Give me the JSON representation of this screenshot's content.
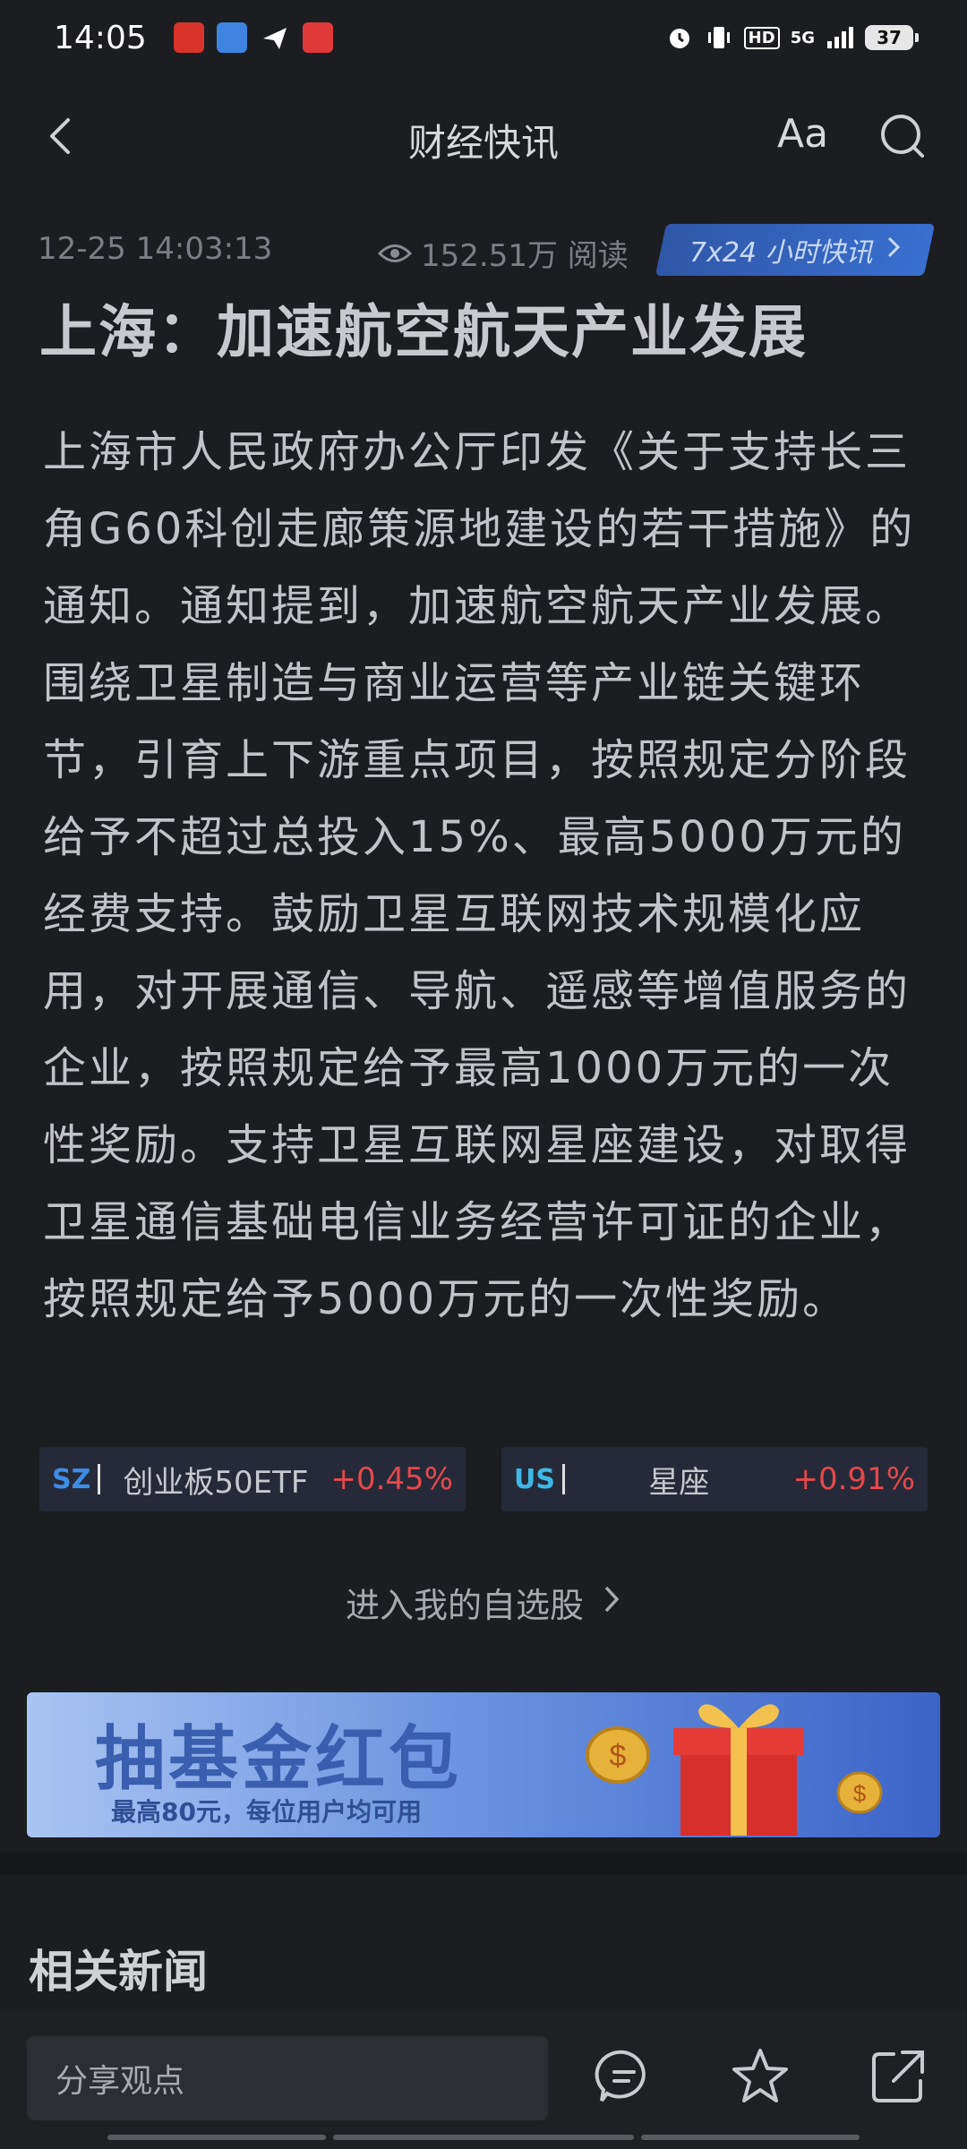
{
  "status_bar": {
    "time": "14:05",
    "battery": "37",
    "network": "5G",
    "hd": "HD"
  },
  "nav": {
    "title": "财经快讯",
    "font_button": "Aa"
  },
  "article": {
    "timestamp": "12-25 14:03:13",
    "views": "152.51万 阅读",
    "badge": "7x24 小时快讯",
    "headline": "上海：加速航空航天产业发展",
    "body": "上海市人民政府办公厅印发《关于支持长三角G60科创走廊策源地建设的若干措施》的通知。通知提到，加速航空航天产业发展。围绕卫星制造与商业运营等产业链关键环节，引育上下游重点项目，按照规定分阶段给予不超过总投入15%、最高5000万元的经费支持。鼓励卫星互联网技术规模化应用，对开展通信、导航、遥感等增值服务的企业，按照规定给予最高1000万元的一次性奖励。支持卫星互联网星座建设，对取得卫星通信基础电信业务经营许可证的企业，按照规定给予5000万元的一次性奖励。"
  },
  "stocks": [
    {
      "market": "SZ",
      "name": "创业板50ETF",
      "change": "+0.45%"
    },
    {
      "market": "US",
      "name": "星座",
      "change": "+0.91%"
    }
  ],
  "watchlist_link": "进入我的自选股",
  "banner": {
    "title": "抽基金红包",
    "subtitle": "最高80元，每位用户均可用"
  },
  "related_news_title": "相关新闻",
  "bottom_bar": {
    "comment_placeholder": "分享观点"
  },
  "colors": {
    "background": "#1c1d21",
    "accent_blue": "#3a6fd0",
    "up_red": "#e5484d"
  }
}
